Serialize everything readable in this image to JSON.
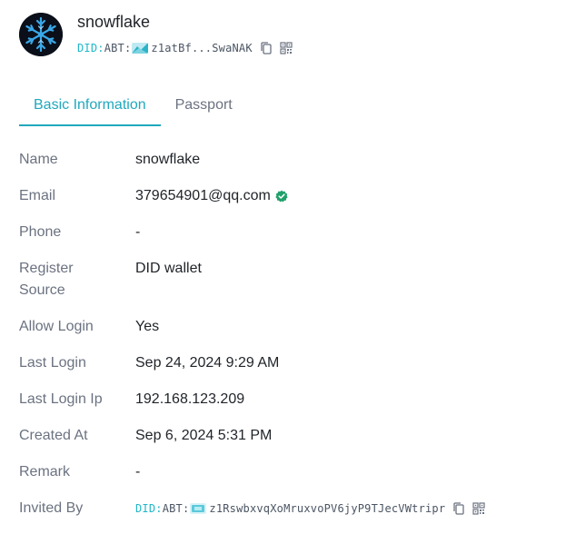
{
  "profile": {
    "name": "snowflake",
    "did_prefix": "DID:",
    "did_abt": "ABT:",
    "did_short": "z1atBf...SwaNAK"
  },
  "tabs": [
    {
      "label": "Basic Information",
      "active": true
    },
    {
      "label": "Passport",
      "active": false
    }
  ],
  "fields": {
    "name": {
      "label": "Name",
      "value": "snowflake"
    },
    "email": {
      "label": "Email",
      "value": "379654901@qq.com",
      "verified": true
    },
    "phone": {
      "label": "Phone",
      "value": "-"
    },
    "register_source": {
      "label": "Register\nSource",
      "value": "DID wallet"
    },
    "allow_login": {
      "label": "Allow Login",
      "value": "Yes"
    },
    "last_login": {
      "label": "Last Login",
      "value": "Sep 24, 2024 9:29 AM"
    },
    "last_login_ip": {
      "label": "Last Login Ip",
      "value": "192.168.123.209"
    },
    "created_at": {
      "label": "Created At",
      "value": "Sep 6, 2024 5:31 PM"
    },
    "remark": {
      "label": "Remark",
      "value": "-"
    },
    "invited_by": {
      "label": "Invited By",
      "did_prefix": "DID:",
      "did_abt": "ABT:",
      "did_full": "z1RswbxvqXoMruxvoPV6jyP9TJecVWtripr"
    }
  },
  "colors": {
    "accent": "#20a8bd",
    "did_prefix": "#20b7c8",
    "verified": "#22a06b",
    "label": "#6b7280",
    "value": "#1f2328"
  },
  "icons": {
    "avatar": "snowflake-avatar",
    "copy": "copy-icon",
    "qr": "qr-code-icon",
    "verified": "verified-check-icon"
  }
}
